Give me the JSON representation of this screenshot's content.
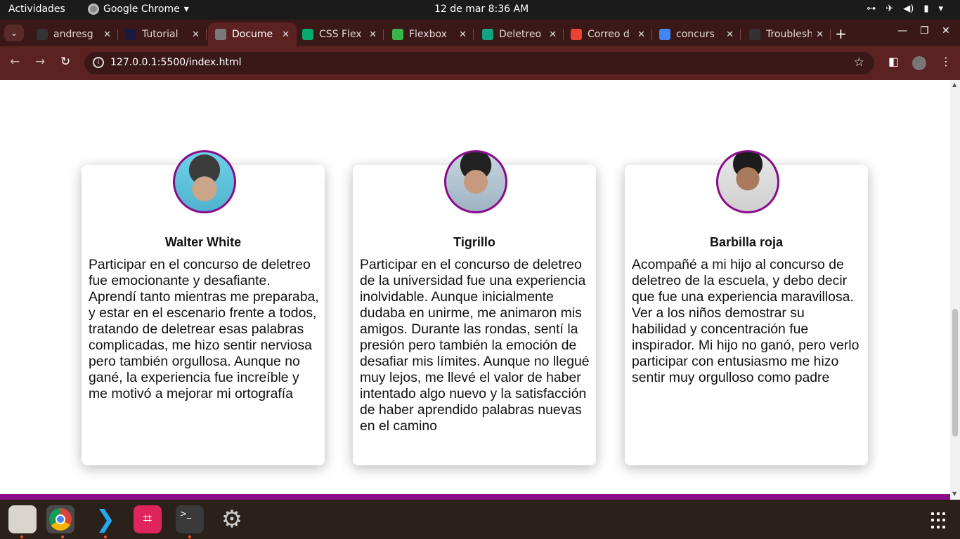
{
  "system": {
    "activities": "Actividades",
    "app_name": "Google Chrome",
    "clock": "12 de mar   8:36 AM"
  },
  "tabs": [
    {
      "title": "andresg",
      "icon": "github-icon",
      "color": "#333333"
    },
    {
      "title": "Tutorial",
      "icon": "angular-icon",
      "color": "#1a1a40"
    },
    {
      "title": "Docume",
      "icon": "globe-icon",
      "color": "#7a7a7a",
      "active": true
    },
    {
      "title": "CSS Flex",
      "icon": "w3-icon",
      "color": "#04aa6d"
    },
    {
      "title": "Flexbox",
      "icon": "frog-icon",
      "color": "#3ab54a"
    },
    {
      "title": "Deletreo",
      "icon": "chatgpt-icon",
      "color": "#10a37f"
    },
    {
      "title": "Correo d",
      "icon": "gmail-icon",
      "color": "#ea4335"
    },
    {
      "title": "concurs",
      "icon": "docs-icon",
      "color": "#4285f4"
    },
    {
      "title": "Troublesh",
      "icon": "github-icon",
      "color": "#333333"
    }
  ],
  "address": {
    "url": "127.0.0.1:5500/index.html"
  },
  "cards": [
    {
      "name": "Walter White",
      "text": "Participar en el concurso de deletreo fue emocionante y desafiante. Aprendí tanto mientras me preparaba, y estar en el escenario frente a todos, tratando de deletrear esas palabras complicadas, me hizo sentir nerviosa pero también orgullosa. Aunque no gané, la experiencia fue increíble y me motivó a mejorar mi ortografía"
    },
    {
      "name": "Tigrillo",
      "text": "Participar en el concurso de deletreo de la universidad fue una experiencia inolvidable. Aunque inicialmente dudaba en unirme, me animaron mis amigos. Durante las rondas, sentí la presión pero también la emoción de desafiar mis límites. Aunque no llegué muy lejos, me llevé el valor de haber intentado algo nuevo y la satisfacción de haber aprendido palabras nuevas en el camino"
    },
    {
      "name": "Barbilla roja",
      "text": "Acompañé a mi hijo al concurso de deletreo de la escuela, y debo decir que fue una experiencia maravillosa. Ver a los niños demostrar su habilidad y concentración fue inspirador. Mi hijo no ganó, pero verlo participar con entusiasmo me hizo sentir muy orgulloso como padre"
    }
  ],
  "colors": {
    "accent": "#8a0c8a",
    "chrome_frame": "#3b1818",
    "chrome_toolbar": "#5c2222"
  }
}
